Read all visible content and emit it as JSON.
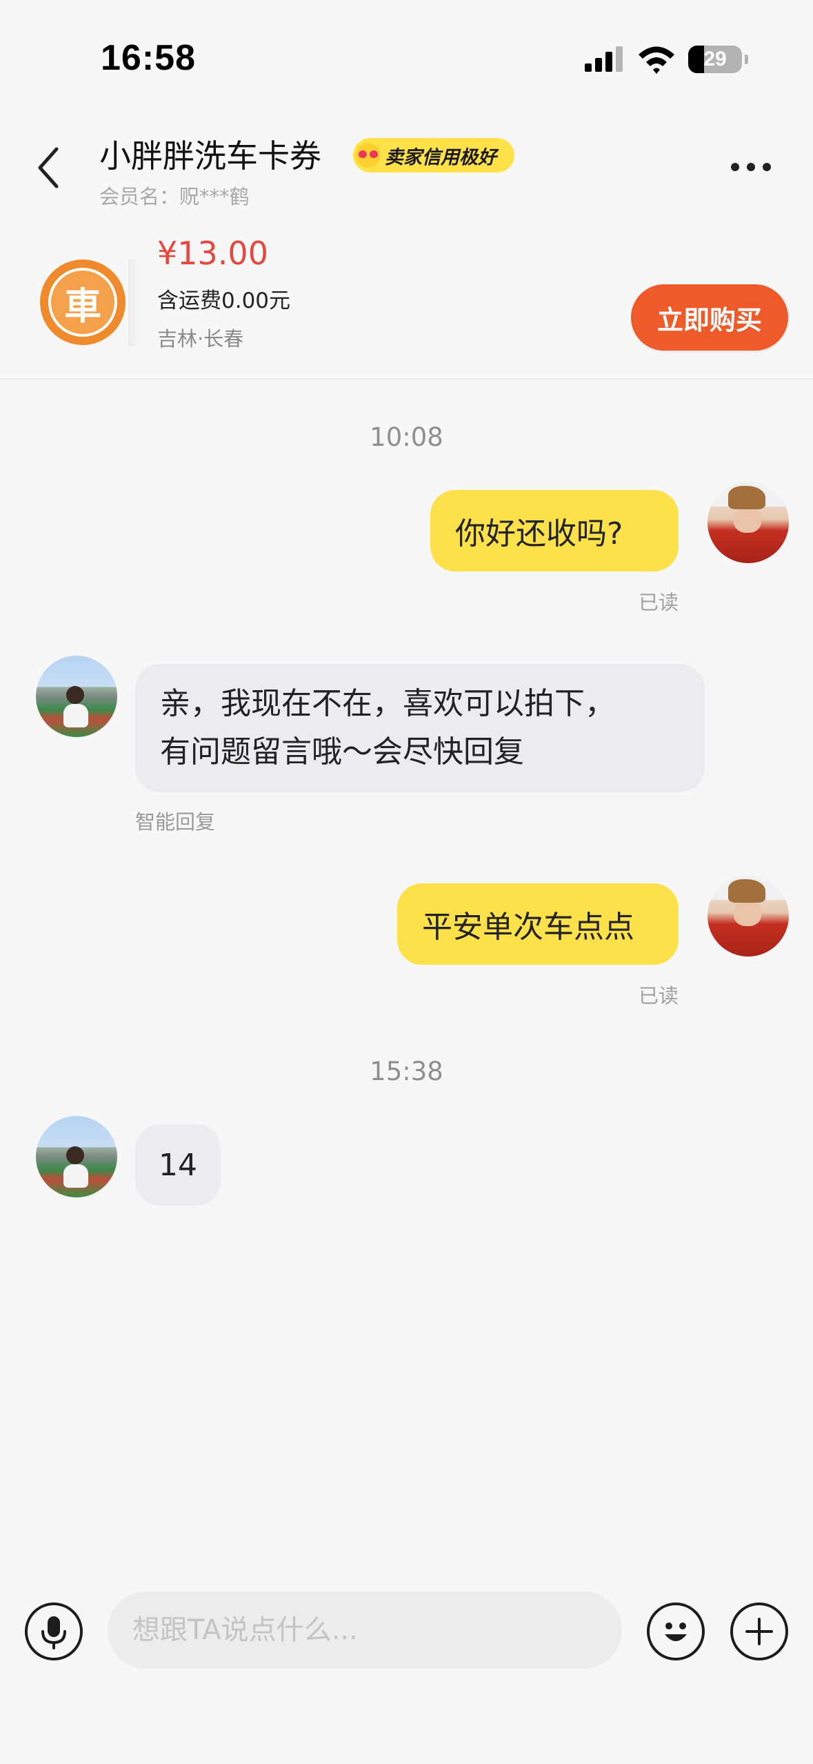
{
  "status_bar": {
    "time": "16:58",
    "battery": "29",
    "battery_level": 0.29
  },
  "header": {
    "title": "小胖胖洗车卡券",
    "credit_badge": "卖家信用极好",
    "member_name": "会员名：贶***鹤"
  },
  "product": {
    "thumb_glyph": "車",
    "price": "¥13.00",
    "shipping": "含运费0.00元",
    "location": "吉林·长春",
    "buy_button": "立即购买"
  },
  "chat": {
    "timestamps": [
      "10:08",
      "15:38"
    ],
    "messages": [
      {
        "from": "me",
        "text": "你好还收吗?",
        "status": "已读"
      },
      {
        "from": "other",
        "lines": [
          "亲，我现在不在，喜欢可以拍下，",
          "有问题留言哦～会尽快回复"
        ],
        "note": "智能回复"
      },
      {
        "from": "me",
        "text": "平安单次车点点",
        "status": "已读"
      },
      {
        "from": "other",
        "text": "14"
      }
    ]
  },
  "input": {
    "placeholder": "想跟TA说点什么..."
  },
  "colors": {
    "bubble_me": "#fde14a",
    "bubble_other": "#ececef",
    "price": "#e5483f",
    "buy_button": "#ef5a2a",
    "badge": "#ffe24a"
  },
  "icons": [
    "signal-icon",
    "wifi-icon",
    "battery-icon",
    "back-icon",
    "more-icon",
    "mic-icon",
    "emoji-icon",
    "plus-icon"
  ]
}
